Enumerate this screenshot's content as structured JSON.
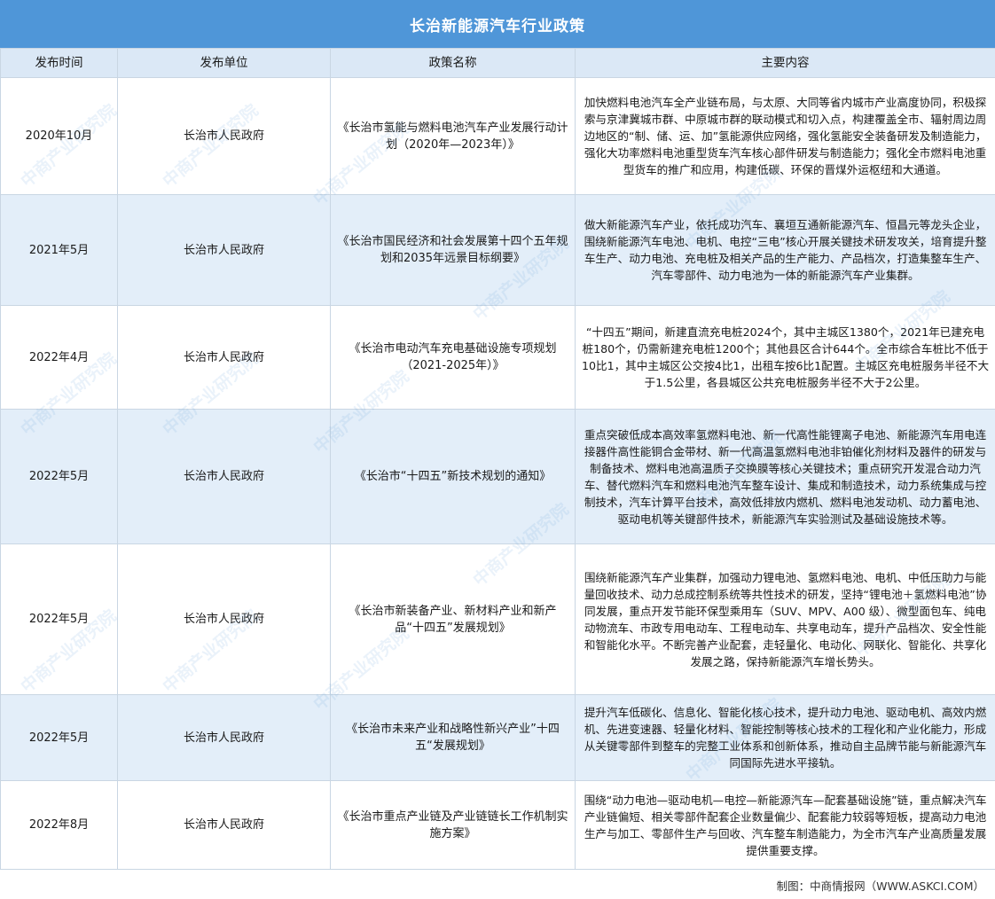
{
  "title": "长治新能源汽车行业政策",
  "headers": {
    "time": "发布时间",
    "unit": "发布单位",
    "name": "政策名称",
    "content": "主要内容"
  },
  "rows": [
    {
      "time": "2020年10月",
      "unit": "长治市人民政府",
      "name": "《长治市氢能与燃料电池汽车产业发展行动计划（2020年—2023年）》",
      "content": "加快燃料电池汽车全产业链布局，与太原、大同等省内城市产业高度协同，积极探索与京津冀城市群、中原城市群的联动模式和切入点，构建覆盖全市、辐射周边周边地区的“制、储、运、加”氢能源供应网络，强化氢能安全装备研发及制造能力，强化大功率燃料电池重型货车汽车核心部件研发与制造能力；强化全市燃料电池重型货车的推广和应用，构建低碳、环保的晋煤外运枢纽和大通道。"
    },
    {
      "time": "2021年5月",
      "unit": "长治市人民政府",
      "name": "《长治市国民经济和社会发展第十四个五年规划和2035年远景目标纲要》",
      "content": "做大新能源汽车产业，依托成功汽车、襄垣互通新能源汽车、恒昌元等龙头企业，围绕新能源汽车电池、电机、电控“三电”核心开展关键技术研发攻关，培育提升整车生产、动力电池、充电桩及相关产品的生产能力、产品档次，打造集整车生产、汽车零部件、动力电池为一体的新能源汽车产业集群。"
    },
    {
      "time": "2022年4月",
      "unit": "长治市人民政府",
      "name": "《长治市电动汽车充电基础设施专项规划（2021-2025年）》",
      "content": "“十四五”期间，新建直流充电桩2024个，其中主城区1380个，2021年已建充电桩180个，仍需新建充电桩1200个；其他县区合计644个。全市综合车桩比不低于10比1，其中主城区公交按4比1，出租车按6比1配置。主城区充电桩服务半径不大于1.5公里，各县城区公共充电桩服务半径不大于2公里。"
    },
    {
      "time": "2022年5月",
      "unit": "长治市人民政府",
      "name": "《长治市“十四五”新技术规划的通知》",
      "content": "重点突破低成本高效率氢燃料电池、新一代高性能锂离子电池、新能源汽车用电连接器件高性能铜合金带材、新一代高温氢燃料电池非铂催化剂材料及器件的研发与制备技术、燃料电池高温质子交换膜等核心关键技术；重点研究开发混合动力汽车、替代燃料汽车和燃料电池汽车整车设计、集成和制造技术，动力系统集成与控制技术，汽车计算平台技术，高效低排放内燃机、燃料电池发动机、动力蓄电池、驱动电机等关键部件技术，新能源汽车实验测试及基础设施技术等。"
    },
    {
      "time": "2022年5月",
      "unit": "长治市人民政府",
      "name": "《长治市新装备产业、新材料产业和新产品“十四五”发展规划》",
      "content": "围绕新能源汽车产业集群，加强动力锂电池、氢燃料电池、电机、中低压助力与能量回收技术、动力总成控制系统等共性技术的研发，坚持“锂电池＋氢燃料电池”协同发展，重点开发节能环保型乘用车（SUV、MPV、A00 级）、微型面包车、纯电动物流车、市政专用电动车、工程电动车、共享电动车，提升产品档次、安全性能和智能化水平。不断完善产业配套，走轻量化、电动化、网联化、智能化、共享化发展之路，保持新能源汽车增长势头。"
    },
    {
      "time": "2022年5月",
      "unit": "长治市人民政府",
      "name": "《长治市未来产业和战略性新兴产业”十四五“发展规划》",
      "content": "提升汽车低碳化、信息化、智能化核心技术，提升动力电池、驱动电机、高效内燃机、先进变速器、轻量化材料、智能控制等核心技术的工程化和产业化能力，形成从关键零部件到整车的完整工业体系和创新体系，推动自主品牌节能与新能源汽车同国际先进水平接轨。"
    },
    {
      "time": "2022年8月",
      "unit": "长治市人民政府",
      "name": "《长治市重点产业链及产业链链长工作机制实施方案》",
      "content": "围绕“动力电池—驱动电机—电控—新能源汽车—配套基础设施”链，重点解决汽车产业链偏短、相关零部件配套企业数量偏少、配套能力较弱等短板，提高动力电池生产与加工、零部件生产与回收、汽车整车制造能力，为全市汽车产业高质量发展提供重要支撑。"
    }
  ],
  "footer": "制图：中商情报网（WWW.ASKCI.COM）",
  "watermark_text": "中商产业研究院",
  "colors": {
    "title_bg": "#4f96d8",
    "header_bg": "#dbe8f6",
    "stripe_bg": "#e3eef9",
    "border": "#c9d6e3"
  }
}
